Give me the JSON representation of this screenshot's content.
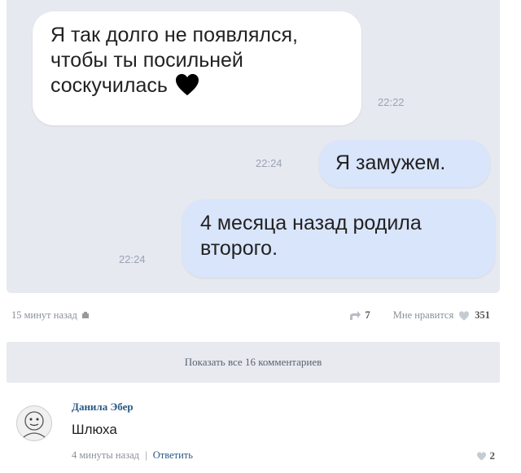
{
  "chat": {
    "messages": [
      {
        "text_line1": "Я так долго не появлялся,",
        "text_line2": "чтобы ты посильней",
        "text_line3": "соскучилась",
        "time": "22:22",
        "emoji": "black-heart"
      },
      {
        "text": "Я замужем.",
        "time": "22:24"
      },
      {
        "text_line1": "4 месяца назад родила",
        "text_line2": "второго.",
        "time": "22:24"
      }
    ]
  },
  "post_meta": {
    "posted": "15 минут назад",
    "reposts": "7",
    "like_label": "Мне нравится",
    "likes": "351"
  },
  "show_all_comments": "Показать все 16 комментариев",
  "comment": {
    "author": "Данила Эбер",
    "text": "Шлюха",
    "time": "4 минуты назад",
    "separator": "|",
    "reply": "Ответить",
    "likes": "2"
  },
  "colors": {
    "chat_bg": "#e7e9f0",
    "bubble_in": "#ffffff",
    "bubble_out": "#d9e5fb",
    "link": "#2a5885"
  }
}
